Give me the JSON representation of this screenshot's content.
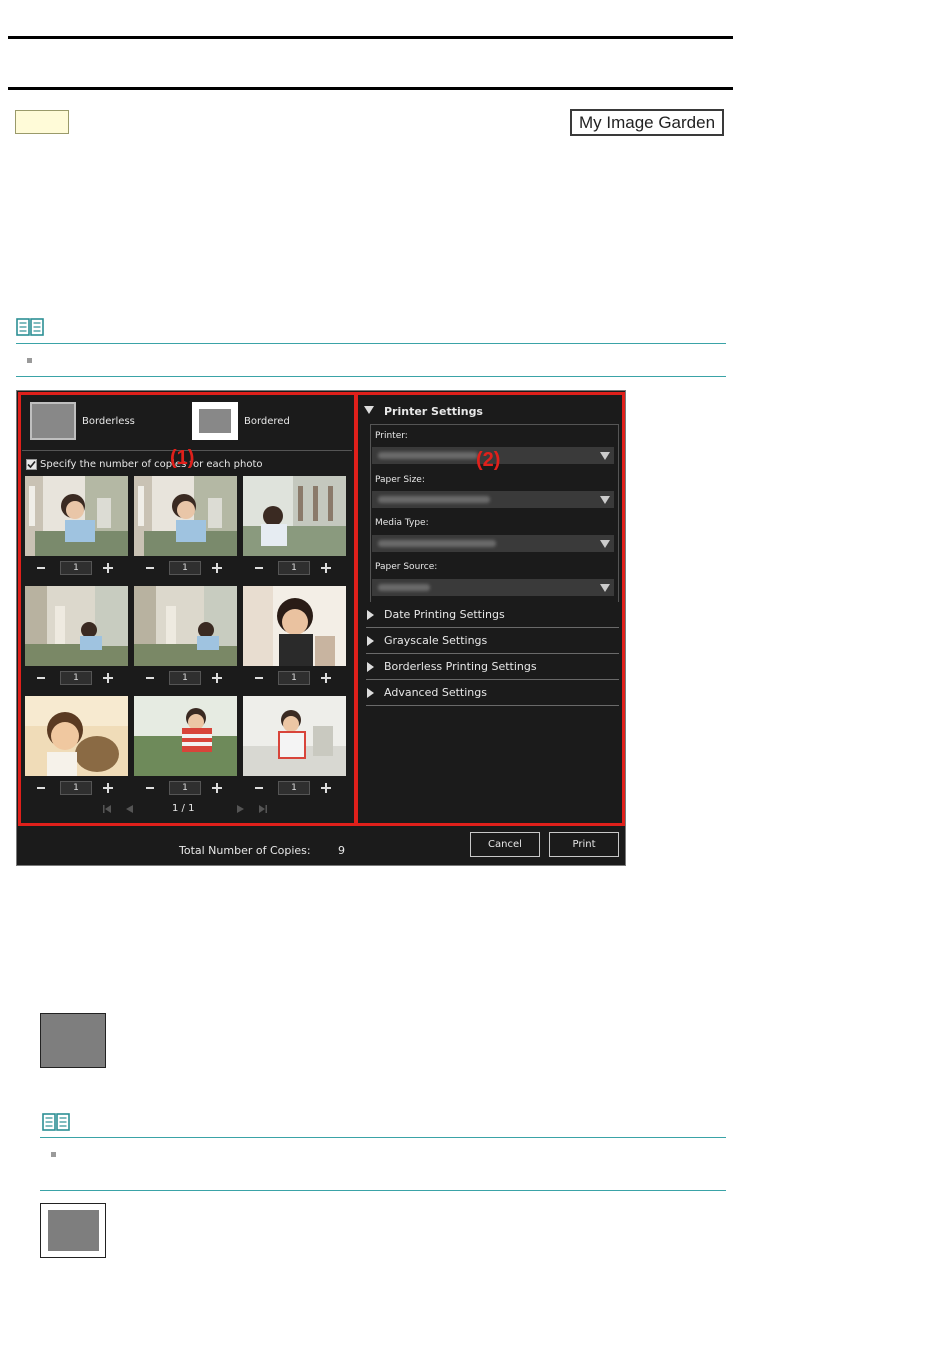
{
  "header": {
    "app_badge_label": "My Image Garden"
  },
  "dialog": {
    "print_modes": {
      "borderless_label": "Borderless",
      "bordered_label": "Bordered"
    },
    "copies_checkbox_label": "Specify the number of copies for each photo",
    "photo_copies": [
      "1",
      "1",
      "1",
      "1",
      "1",
      "1",
      "1",
      "1",
      "1"
    ],
    "pagination": "1 / 1",
    "callout_1": "(1)",
    "callout_2": "(2)",
    "printer_settings": {
      "title": "Printer Settings",
      "printer_label": "Printer:",
      "paper_size_label": "Paper Size:",
      "media_type_label": "Media Type:",
      "paper_source_label": "Paper Source:"
    },
    "sections": [
      "Date Printing Settings",
      "Grayscale Settings",
      "Borderless Printing Settings",
      "Advanced Settings"
    ],
    "footer": {
      "total_label": "Total Number of Copies:",
      "total_value": "9",
      "cancel_label": "Cancel",
      "print_label": "Print"
    }
  },
  "colors": {
    "callout_red": "#e0201b",
    "note_rule_teal": "#3aa3a7",
    "dialog_bg": "#1b1b1b"
  },
  "icons": [
    "note-book-icon",
    "checkbox-checked-icon",
    "dropdown-arrow-icon",
    "expand-triangle-icon",
    "first-page-icon",
    "prev-page-icon",
    "next-page-icon",
    "last-page-icon"
  ]
}
